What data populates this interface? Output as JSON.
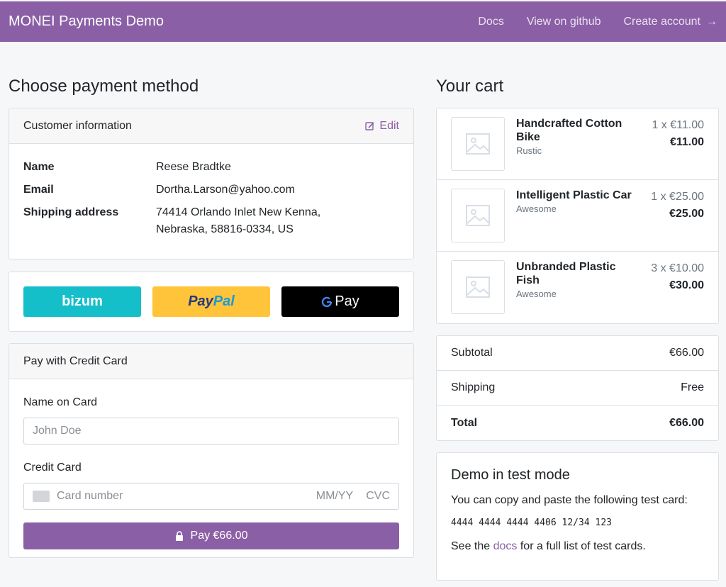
{
  "nav": {
    "brand": "MONEI Payments Demo",
    "links": [
      "Docs",
      "View on github",
      "Create account"
    ],
    "arrow": "→"
  },
  "left": {
    "title": "Choose payment method",
    "customer": {
      "header": "Customer information",
      "edit": "Edit",
      "rows": [
        {
          "label": "Name",
          "value": "Reese Bradtke"
        },
        {
          "label": "Email",
          "value": "Dortha.Larson@yahoo.com"
        },
        {
          "label": "Shipping address",
          "value": "74414 Orlando Inlet New Kenna, Nebraska, 58816-0334, US"
        }
      ]
    },
    "wallets": {
      "bizum": "bizum",
      "paypal_a": "Pay",
      "paypal_b": "Pal",
      "gpay": "Pay"
    },
    "card": {
      "header": "Pay with Credit Card",
      "name_label": "Name on Card",
      "name_placeholder": "John Doe",
      "cc_label": "Credit Card",
      "cc_placeholder": "Card number",
      "expiry": "MM/YY",
      "cvc": "CVC",
      "pay": "Pay €66.00"
    }
  },
  "right": {
    "title": "Your cart",
    "items": [
      {
        "name": "Handcrafted Cotton Bike",
        "sub": "Rustic",
        "qty": "1 x €11.00",
        "total": "€11.00"
      },
      {
        "name": "Intelligent Plastic Car",
        "sub": "Awesome",
        "qty": "1 x €25.00",
        "total": "€25.00"
      },
      {
        "name": "Unbranded Plastic Fish",
        "sub": "Awesome",
        "qty": "3 x €10.00",
        "total": "€30.00"
      }
    ],
    "totals": [
      {
        "label": "Subtotal",
        "value": "€66.00"
      },
      {
        "label": "Shipping",
        "value": "Free"
      },
      {
        "label": "Total",
        "value": "€66.00"
      }
    ],
    "demo": {
      "title": "Demo in test mode",
      "text": "You can copy and paste the following test card:",
      "card": "4444 4444 4444 4406 12/34 123",
      "see": "See the",
      "docs": "docs",
      "rest": "for a full list of test cards."
    }
  },
  "colors": {
    "accent": "#8b5fa6",
    "bizum": "#15bfc9",
    "paypal": "#ffc43a"
  }
}
